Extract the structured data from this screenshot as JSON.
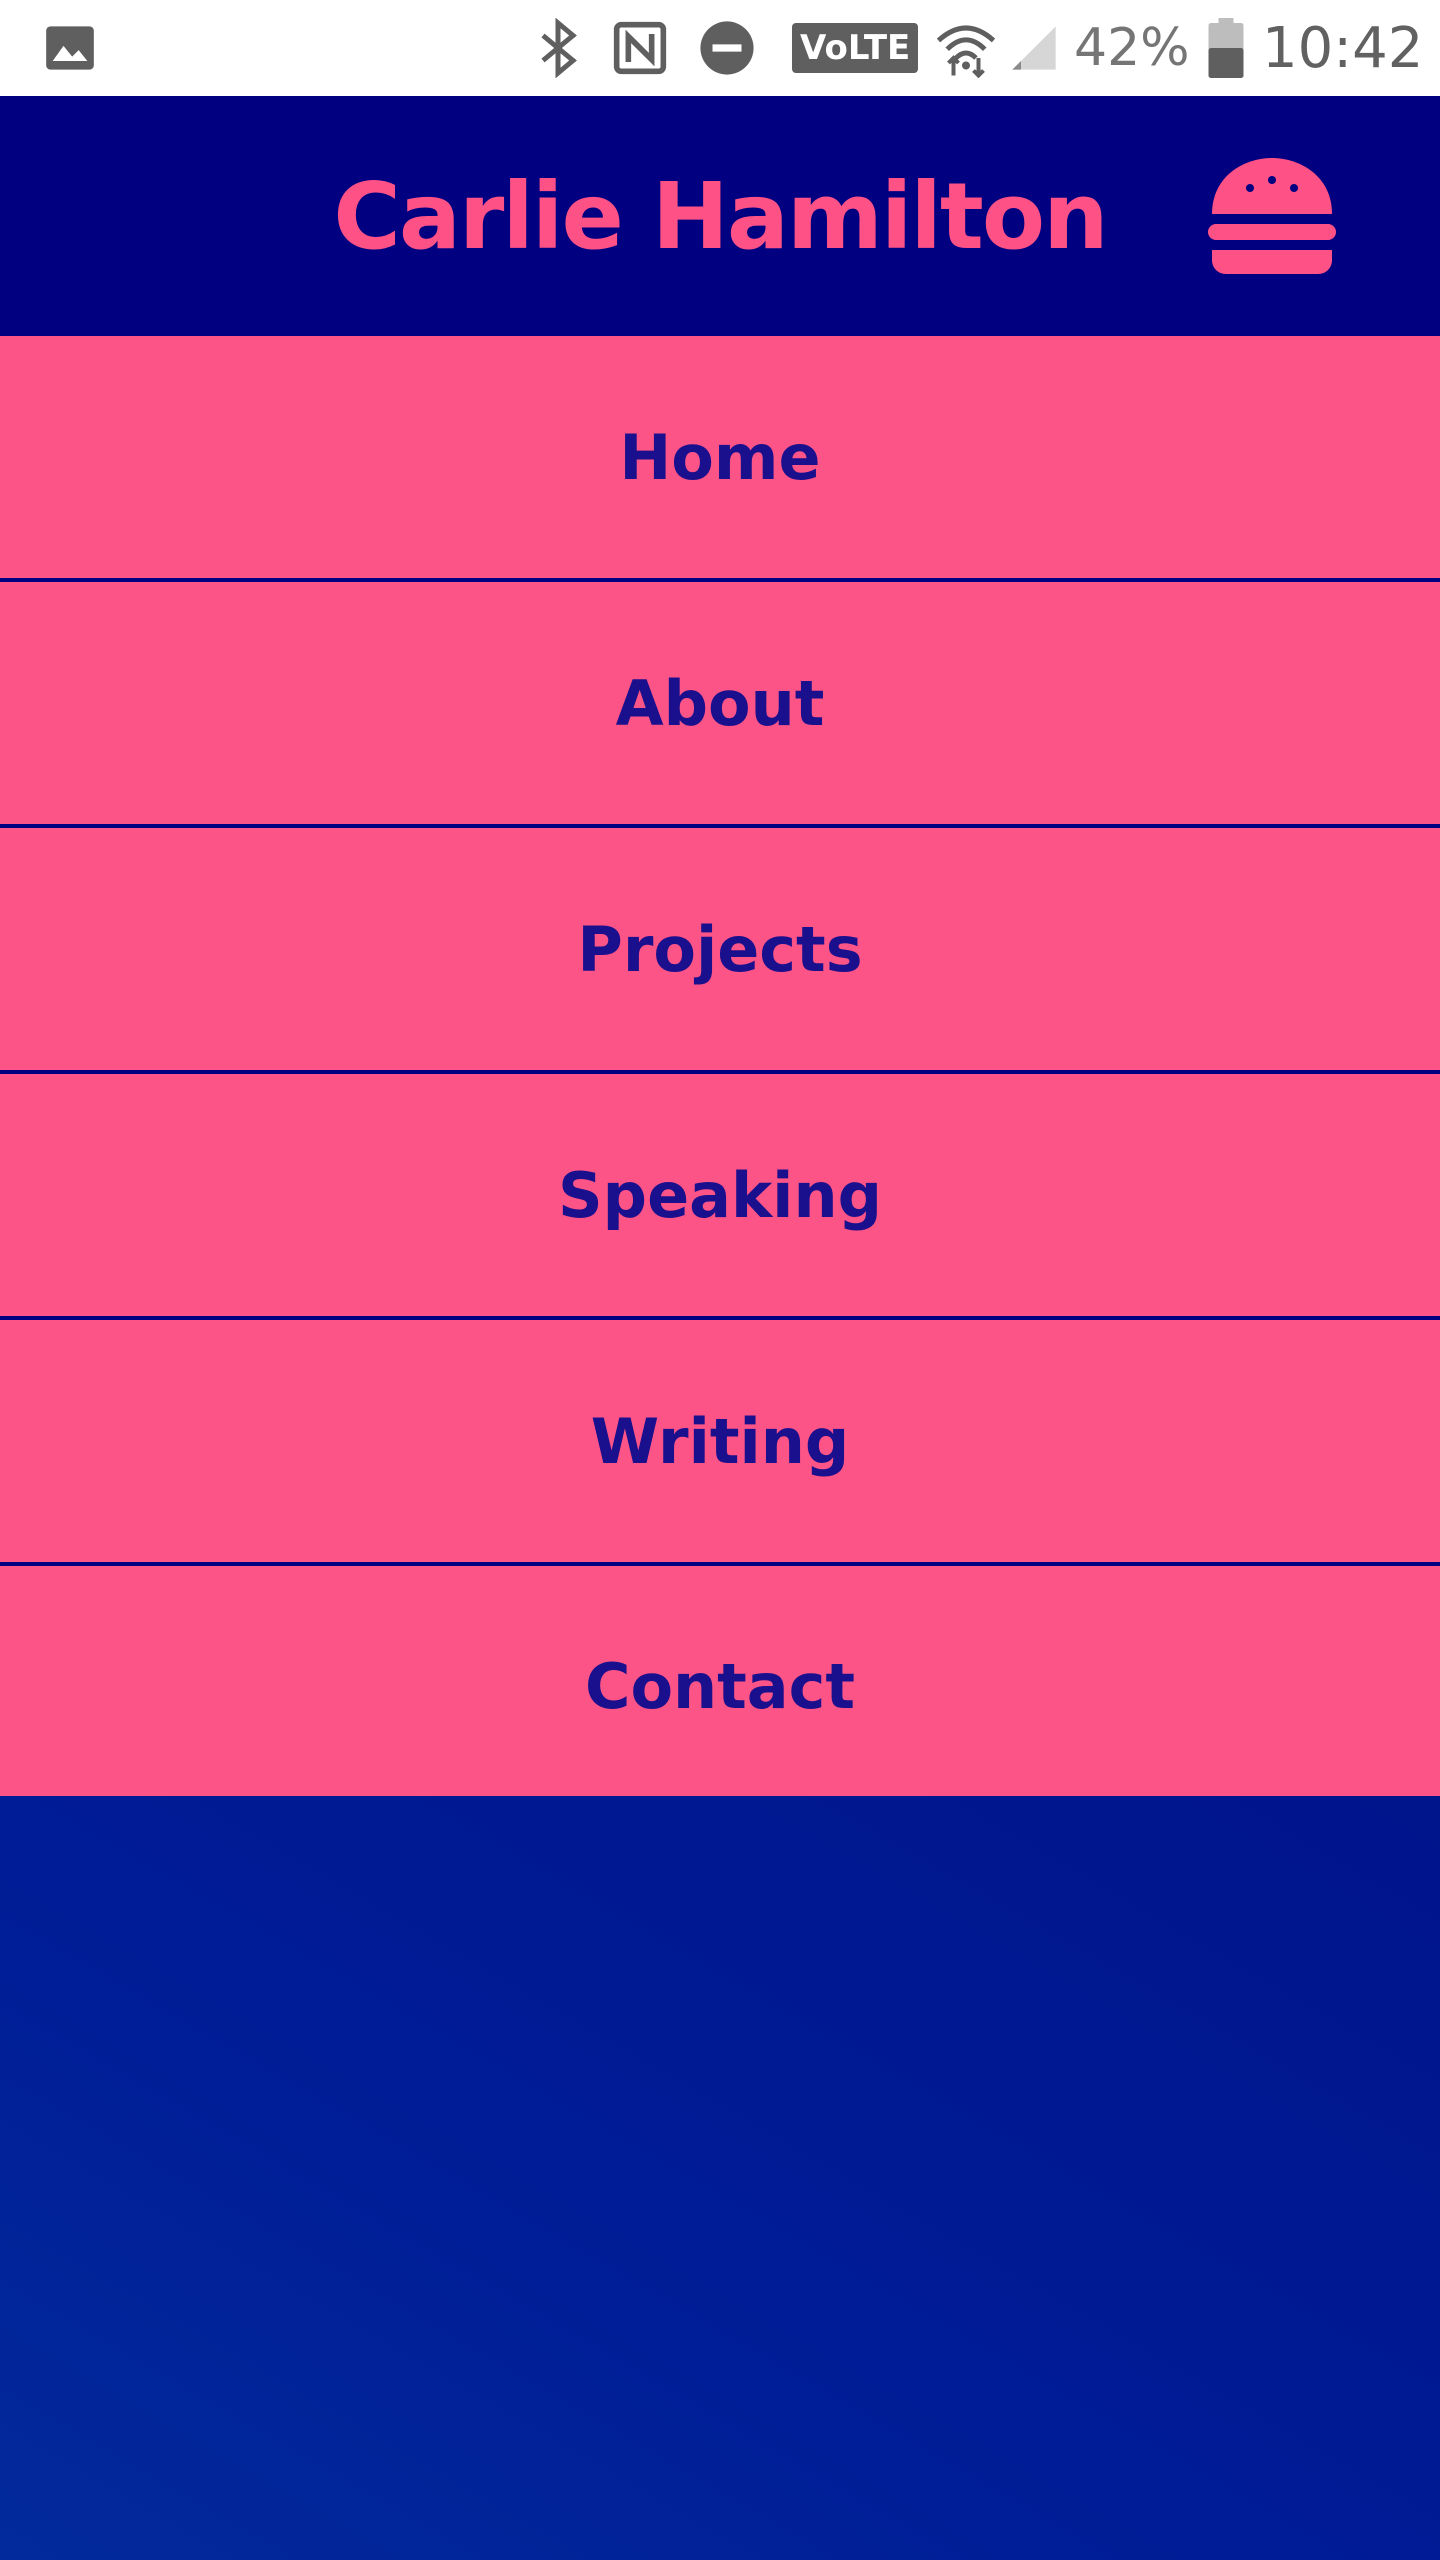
{
  "status_bar": {
    "battery_percent": "42%",
    "time": "10:42",
    "volte_label": "VoLTE",
    "icons": [
      "gallery-icon",
      "bluetooth-icon",
      "nfc-icon",
      "do-not-disturb-icon",
      "wifi-icon",
      "cell-signal-icon",
      "battery-icon"
    ]
  },
  "header": {
    "title": "Carlie Hamilton",
    "menu_icon": "hamburger-icon"
  },
  "nav": {
    "items": [
      {
        "label": "Home"
      },
      {
        "label": "About"
      },
      {
        "label": "Projects"
      },
      {
        "label": "Speaking"
      },
      {
        "label": "Writing"
      },
      {
        "label": "Contact"
      }
    ]
  },
  "colors": {
    "navy": "#000080",
    "pink": "#fc5487",
    "title_pink": "#fe5186",
    "nav_text": "#1a0f8c",
    "content_blue": "#001c96"
  }
}
